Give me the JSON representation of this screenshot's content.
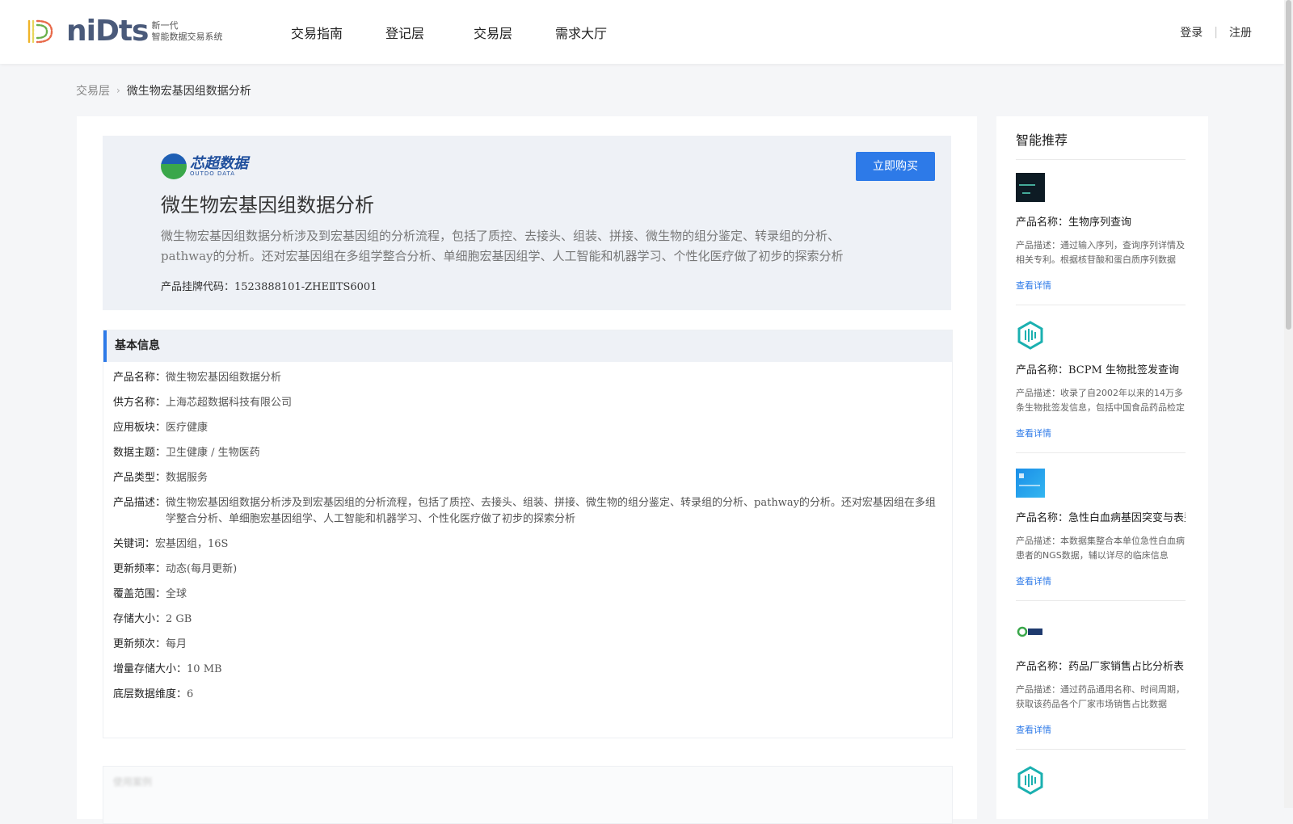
{
  "header": {
    "logo": {
      "word": "niDts",
      "sub_line1": "新一代",
      "sub_line2": "智能数据交易系统"
    },
    "nav": [
      "交易指南",
      "登记层",
      "交易层",
      "需求大厅"
    ],
    "login": "登录",
    "register": "注册",
    "separator": "|"
  },
  "breadcrumb": {
    "parent": "交易层",
    "current": "微生物宏基因组数据分析"
  },
  "hero": {
    "brand_cn": "芯超数据",
    "brand_en": "OUTDO DATA",
    "buy_button": "立即购买",
    "title": "微生物宏基因组数据分析",
    "description": "微生物宏基因组数据分析涉及到宏基因组的分析流程，包括了质控、去接头、组装、拼接、微生物的组分鉴定、转录组的分析、pathway的分析。还对宏基因组在多组学整合分析、单细胞宏基因组学、人工智能和机器学习、个性化医疗做了初步的探索分析",
    "code_label": "产品挂牌代码：",
    "code_value": "1523888101-ZHEⅡTS6001"
  },
  "basic_info": {
    "heading": "基本信息",
    "rows": [
      {
        "label": "产品名称：",
        "value": "微生物宏基因组数据分析"
      },
      {
        "label": "供方名称：",
        "value": "上海芯超数据科技有限公司"
      },
      {
        "label": "应用板块：",
        "value": "医疗健康"
      },
      {
        "label": "数据主题：",
        "value": "卫生健康 / 生物医药"
      },
      {
        "label": "产品类型：",
        "value": "数据服务"
      },
      {
        "label": "产品描述：",
        "value": "微生物宏基因组数据分析涉及到宏基因组的分析流程，包括了质控、去接头、组装、拼接、微生物的组分鉴定、转录组的分析、pathway的分析。还对宏基因组在多组学整合分析、单细胞宏基因组学、人工智能和机器学习、个性化医疗做了初步的探索分析"
      },
      {
        "label": "关键词：",
        "value": "宏基因组，16S"
      },
      {
        "label": "更新频率：",
        "value": "动态(每月更新)"
      },
      {
        "label": "覆盖范围：",
        "value": "全球"
      },
      {
        "label": "存储大小：",
        "value": "2 GB"
      },
      {
        "label": "更新频次：",
        "value": "每月"
      },
      {
        "label": "增量存储大小：",
        "value": "10 MB"
      },
      {
        "label": "底层数据维度：",
        "value": "6"
      }
    ]
  },
  "next_section_blurred": "使用案例",
  "sidebar": {
    "title": "智能推荐",
    "name_label": "产品名称：",
    "desc_label": "产品描述：",
    "link_label": "查看详情",
    "items": [
      {
        "name": "生物序列查询",
        "desc": "通过输入序列，查询序列详情及相关专利。根据核苷酸和蛋白质序列数据",
        "thumb": "dark-thumbnail"
      },
      {
        "name": "BCPM 生物批签发查询",
        "desc": "收录了自2002年以来的14万多条生物批签发信息，包括中国食品药品检定研究院",
        "thumb": "teal-hex-icon"
      },
      {
        "name": "急性白血病基因突变与表型",
        "desc": "本数据集整合本单位急性白血病患者的NGS数据，辅以详尽的临床信息",
        "thumb": "blue-thumbnail"
      },
      {
        "name": "药品厂家销售占比分析表",
        "desc": "通过药品通用名称、时间周期，获取该药品各个厂家市场销售占比数据",
        "thumb": "pharma-logo"
      }
    ]
  },
  "colors": {
    "accent": "#2d7ae8",
    "hero_bg": "#eef1f6",
    "page_bg": "#f5f6f8",
    "teal": "#1bb0b0"
  }
}
